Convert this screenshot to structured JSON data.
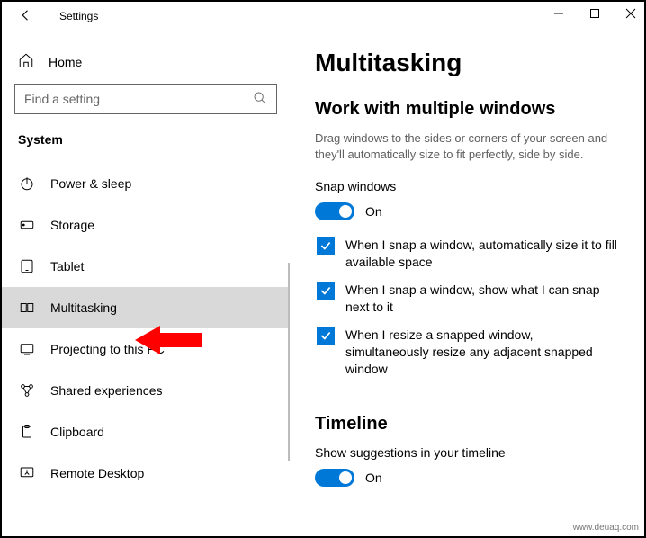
{
  "window": {
    "title": "Settings"
  },
  "sidebar": {
    "home": "Home",
    "search_placeholder": "Find a setting",
    "category": "System",
    "items": [
      {
        "label": "Power & sleep"
      },
      {
        "label": "Storage"
      },
      {
        "label": "Tablet"
      },
      {
        "label": "Multitasking"
      },
      {
        "label": "Projecting to this PC"
      },
      {
        "label": "Shared experiences"
      },
      {
        "label": "Clipboard"
      },
      {
        "label": "Remote Desktop"
      }
    ]
  },
  "content": {
    "heading": "Multitasking",
    "section1_title": "Work with multiple windows",
    "section1_desc": "Drag windows to the sides or corners of your screen and they'll automatically size to fit perfectly, side by side.",
    "snap_label": "Snap windows",
    "snap_toggle_state": "On",
    "checks": [
      "When I snap a window, automatically size it to fill available space",
      "When I snap a window, show what I can snap next to it",
      "When I resize a snapped window, simultaneously resize any adjacent snapped window"
    ],
    "section2_title": "Timeline",
    "timeline_label": "Show suggestions in your timeline",
    "timeline_toggle_state": "On"
  },
  "watermark": "www.deuaq.com"
}
